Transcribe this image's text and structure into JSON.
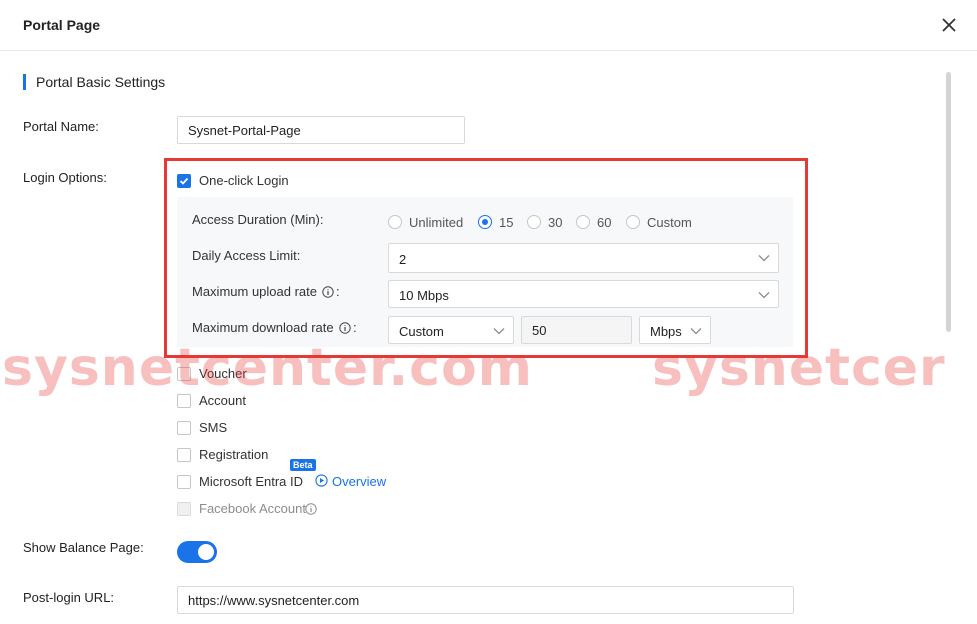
{
  "dialog": {
    "title": "Portal Page"
  },
  "section": {
    "title": "Portal Basic Settings"
  },
  "portal_name": {
    "label": "Portal Name:",
    "value": "Sysnet-Portal-Page"
  },
  "login_options": {
    "label": "Login Options:",
    "one_click": {
      "label": "One-click Login",
      "checked": true
    },
    "access_duration": {
      "label": "Access Duration (Min):",
      "options": [
        "Unlimited",
        "15",
        "30",
        "60",
        "Custom"
      ],
      "selected": "15"
    },
    "daily_limit": {
      "label": "Daily Access Limit:",
      "value": "2"
    },
    "upload_rate": {
      "label": "Maximum upload rate",
      "value": "10 Mbps"
    },
    "download_rate": {
      "label": "Maximum download rate",
      "mode": "Custom",
      "value": "50",
      "unit": "Mbps"
    },
    "voucher": "Voucher",
    "account": "Account",
    "sms": "SMS",
    "registration": "Registration",
    "entra": {
      "label": "Microsoft Entra ID",
      "badge": "Beta",
      "link": "Overview"
    },
    "facebook": "Facebook Account"
  },
  "balance_page": {
    "label": "Show Balance Page:",
    "enabled": true
  },
  "post_login": {
    "label": "Post-login URL:",
    "value": "https://www.sysnetcenter.com"
  },
  "watermark": {
    "text_left": "sysnetcenter.com",
    "text_right": "sysnetcer"
  },
  "colors": {
    "accent": "#1a73e8",
    "highlight": "#e53935"
  }
}
